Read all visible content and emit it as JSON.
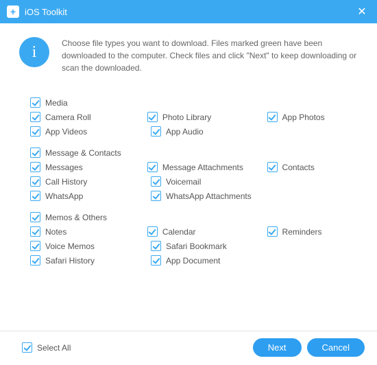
{
  "titlebar": {
    "app_icon_glyph": "+",
    "title": "iOS Toolkit",
    "close_glyph": "✕"
  },
  "info": {
    "icon_glyph": "i",
    "text": "Choose file types you want to download. Files marked green have been downloaded to the computer. Check files and click \"Next\" to keep downloading or scan the downloaded."
  },
  "groups": [
    {
      "header": {
        "label": "Media",
        "checked": true
      },
      "rows": [
        [
          {
            "label": "Camera Roll",
            "checked": true
          },
          {
            "label": "Photo Library",
            "checked": true
          },
          {
            "label": "App Photos",
            "checked": true
          }
        ],
        [
          {
            "label": "App Videos",
            "checked": true
          },
          {
            "label": "App Audio",
            "checked": true
          }
        ]
      ]
    },
    {
      "header": {
        "label": "Message & Contacts",
        "checked": true
      },
      "rows": [
        [
          {
            "label": "Messages",
            "checked": true
          },
          {
            "label": "Message Attachments",
            "checked": true
          },
          {
            "label": "Contacts",
            "checked": true
          }
        ],
        [
          {
            "label": "Call History",
            "checked": true
          },
          {
            "label": "Voicemail",
            "checked": true
          }
        ],
        [
          {
            "label": "WhatsApp",
            "checked": true
          },
          {
            "label": "WhatsApp Attachments",
            "checked": true
          }
        ]
      ]
    },
    {
      "header": {
        "label": "Memos & Others",
        "checked": true
      },
      "rows": [
        [
          {
            "label": "Notes",
            "checked": true
          },
          {
            "label": "Calendar",
            "checked": true
          },
          {
            "label": "Reminders",
            "checked": true
          }
        ],
        [
          {
            "label": "Voice Memos",
            "checked": true
          },
          {
            "label": "Safari Bookmark",
            "checked": true
          }
        ],
        [
          {
            "label": "Safari History",
            "checked": true
          },
          {
            "label": "App Document",
            "checked": true
          }
        ]
      ]
    }
  ],
  "footer": {
    "select_all": {
      "label": "Select All",
      "checked": true
    },
    "next_label": "Next",
    "cancel_label": "Cancel"
  }
}
